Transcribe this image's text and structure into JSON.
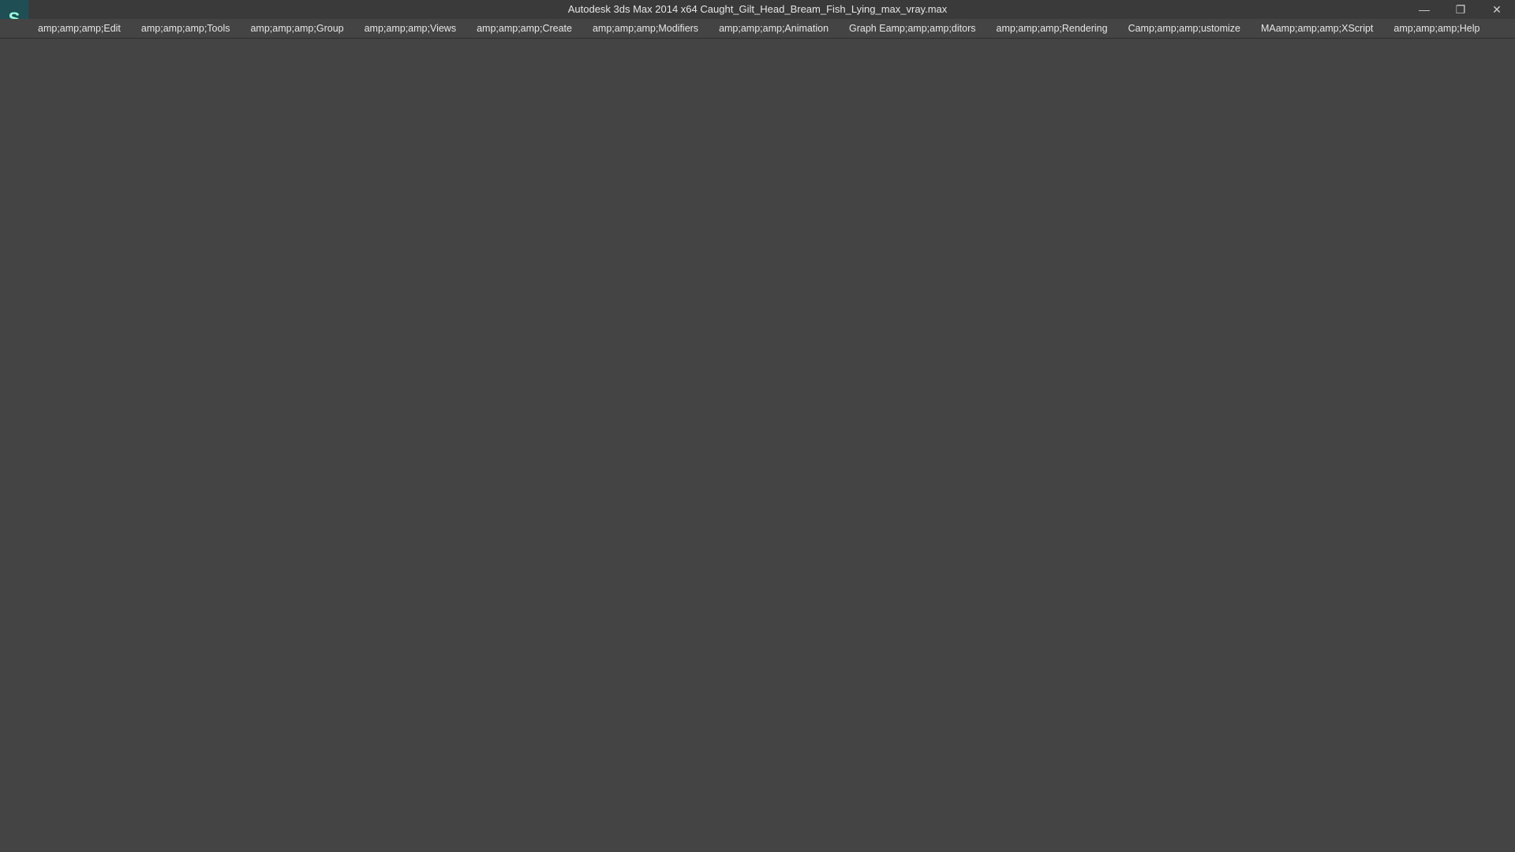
{
  "window": {
    "title": "Autodesk 3ds Max  2014 x64     Caught_Gilt_Head_Bream_Fish_Lying_max_vray.max",
    "minimize": "—",
    "restore": "❐",
    "close": "✕"
  },
  "menubar": {
    "items": [
      "amp;amp;amp;Edit",
      "amp;amp;amp;Tools",
      "amp;amp;amp;Group",
      "amp;amp;amp;Views",
      "amp;amp;amp;Create",
      "amp;amp;amp;Modifiers",
      "amp;amp;amp;Animation",
      "Graph Eamp;amp;amp;ditors",
      "amp;amp;amp;Rendering",
      "Camp;amp;amp;ustomize",
      "MAamp;amp;amp;XScript",
      "amp;amp;amp;Help"
    ]
  }
}
